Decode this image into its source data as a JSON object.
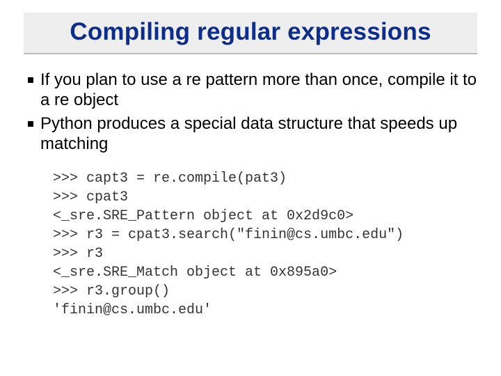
{
  "title": "Compiling regular expressions",
  "bullets": [
    "If you plan to use a re pattern more than once, compile it to a re object",
    "Python produces a special data structure that speeds up matching"
  ],
  "code_lines": [
    ">>> capt3 = re.compile(pat3)",
    ">>> cpat3",
    "<_sre.SRE_Pattern object at 0x2d9c0>",
    ">>> r3 = cpat3.search(\"finin@cs.umbc.edu\")",
    ">>> r3",
    "<_sre.SRE_Match object at 0x895a0>",
    ">>> r3.group()",
    "'finin@cs.umbc.edu'"
  ]
}
